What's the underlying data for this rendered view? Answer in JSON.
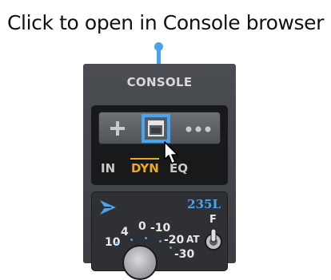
{
  "caption": "Click to open in Console browser",
  "panel": {
    "title": "CONSOLE",
    "buttons": {
      "add_icon": "plus-icon",
      "console_icon": "window-icon",
      "more_icon": "ellipsis-icon"
    },
    "tabs": [
      {
        "label": "IN",
        "active": false
      },
      {
        "label": "DYN",
        "active": true
      },
      {
        "label": "EQ",
        "active": false
      }
    ]
  },
  "module": {
    "name": "235L",
    "scale": [
      "10",
      "4",
      "0",
      "-10",
      "-20",
      "-30"
    ],
    "switch_label_top": "F",
    "switch_label_side": "AT"
  },
  "colors": {
    "accent_blue": "#4aa3ef",
    "active_tab": "#f0a81c",
    "panel_bg": "#3b3e42"
  }
}
